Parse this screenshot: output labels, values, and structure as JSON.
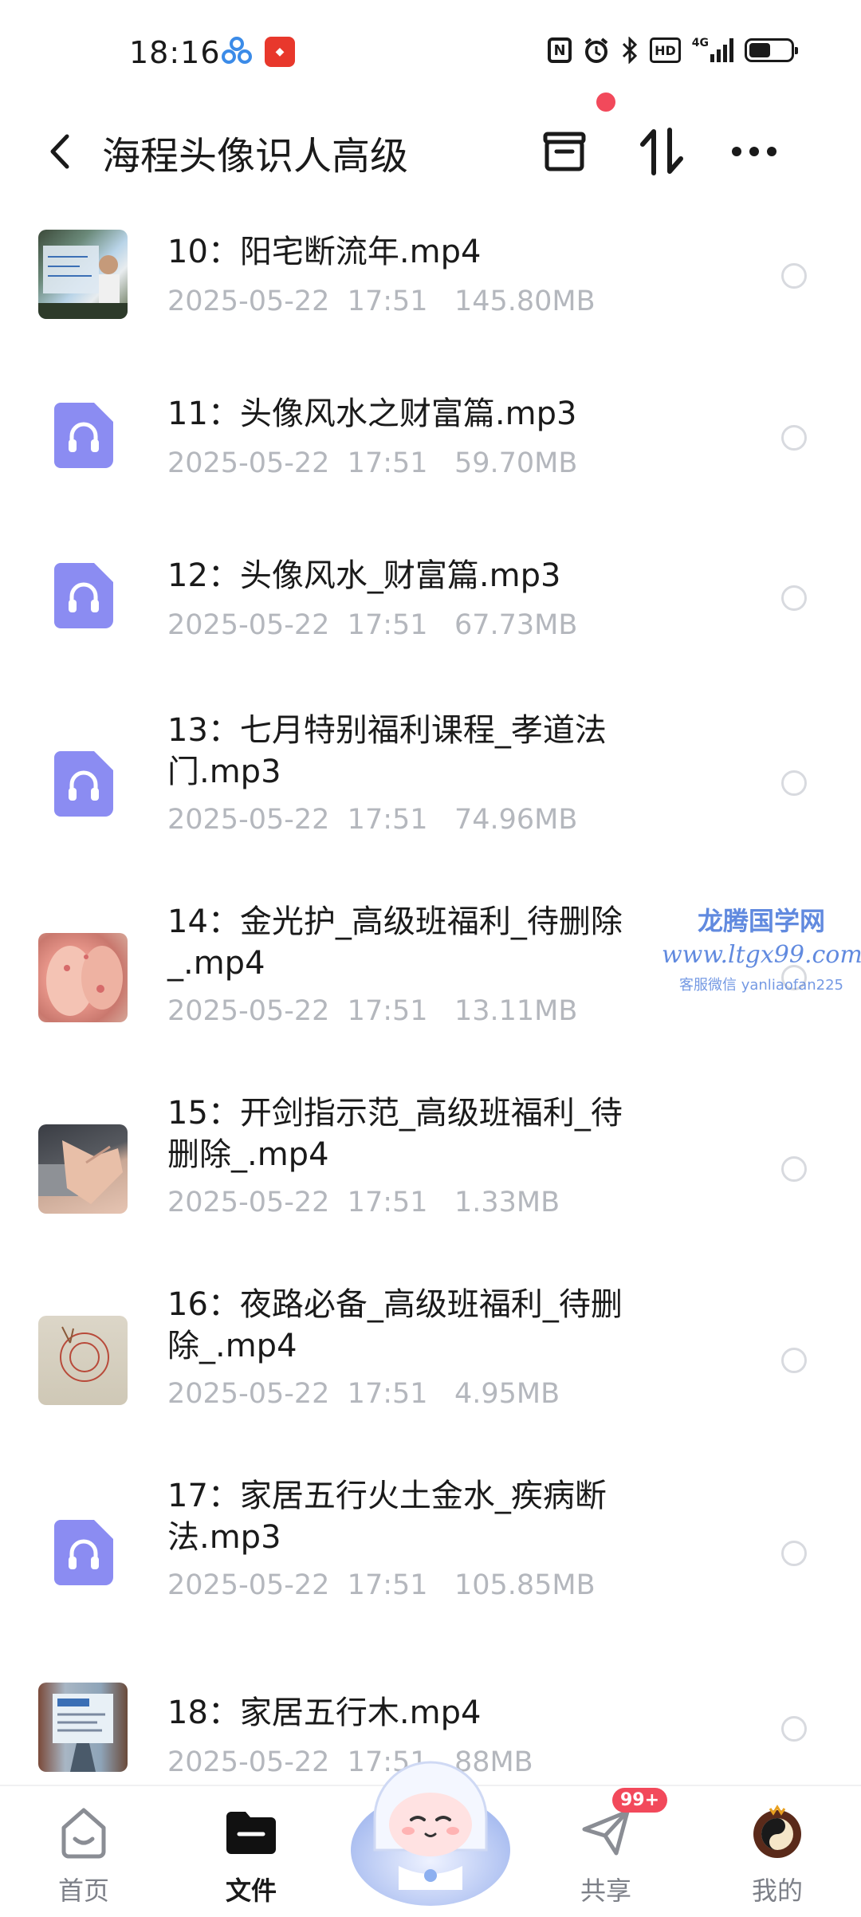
{
  "status_bar": {
    "time": "18:16",
    "app_icons": [
      "cloud-app-icon",
      "red-app-icon"
    ],
    "right_icons": [
      "nfc-icon",
      "alarm-icon",
      "bluetooth-icon",
      "hd-icon",
      "signal-4g-icon",
      "battery-icon"
    ],
    "hd_label": "HD",
    "network_label": "4G"
  },
  "header": {
    "title": "海程头像识人高级",
    "actions": [
      "archive-icon",
      "sort-icon",
      "more-icon"
    ]
  },
  "files": [
    {
      "name": "10：阳宅断流年.mp4",
      "date": "2025-05-22",
      "time": "17:51",
      "size": "145.80MB",
      "type": "video",
      "thumb": "whiteboard"
    },
    {
      "name": "11：头像风水之财富篇.mp3",
      "date": "2025-05-22",
      "time": "17:51",
      "size": "59.70MB",
      "type": "audio"
    },
    {
      "name": "12：头像风水_财富篇.mp3",
      "date": "2025-05-22",
      "time": "17:51",
      "size": "67.73MB",
      "type": "audio"
    },
    {
      "name": "13：七月特别福利课程_孝道法门.mp3",
      "date": "2025-05-22",
      "time": "17:51",
      "size": "74.96MB",
      "type": "audio"
    },
    {
      "name": "14：金光护_高级班福利_待删除_.mp4",
      "date": "2025-05-22",
      "time": "17:51",
      "size": "13.11MB",
      "type": "video",
      "thumb": "hands"
    },
    {
      "name": "15：开剑指示范_高级班福利_待删除_.mp4",
      "date": "2025-05-22",
      "time": "17:51",
      "size": "1.33MB",
      "type": "video",
      "thumb": "palm"
    },
    {
      "name": "16：夜路必备_高级班福利_待删除_.mp4",
      "date": "2025-05-22",
      "time": "17:51",
      "size": "4.95MB",
      "type": "video",
      "thumb": "paper"
    },
    {
      "name": "17：家居五行火土金水_疾病断法.mp3",
      "date": "2025-05-22",
      "time": "17:51",
      "size": "105.85MB",
      "type": "audio"
    },
    {
      "name": "18：家居五行木.mp4",
      "date": "2025-05-22",
      "time": "17:51",
      "size": "88MB",
      "type": "video",
      "thumb": "screen"
    }
  ],
  "watermark": {
    "name": "龙腾国学网",
    "url": "www.ltgx99.com",
    "contact": "客服微信 yanliaofan225"
  },
  "bottom_nav": [
    {
      "label": "首页",
      "icon": "home-icon",
      "active": false
    },
    {
      "label": "文件",
      "icon": "folder-icon",
      "active": true
    },
    {
      "label": "共享",
      "icon": "send-icon",
      "active": false,
      "badge": "99+"
    },
    {
      "label": "我的",
      "icon": "avatar-icon",
      "active": false
    }
  ],
  "colors": {
    "accent": "#8b8cf2",
    "badge": "#f2495b",
    "meta_text": "#b4b7bd"
  }
}
